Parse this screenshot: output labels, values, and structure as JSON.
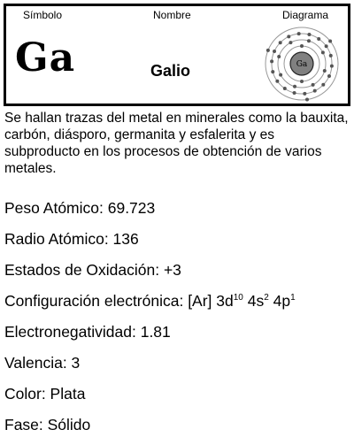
{
  "header": {
    "symbol_label": "Símbolo",
    "name_label": "Nombre",
    "diagram_label": "Diagrama"
  },
  "element": {
    "symbol": "Ga",
    "name": "Galio",
    "diagram_symbol": "Ga"
  },
  "description": "Se hallan trazas del metal en minerales como la bauxita, carbón, diásporo, germanita y esfalerita y es subproducto en los procesos de obtención de varios metales.",
  "properties": {
    "atomic_weight": "Peso Atómico: 69.723",
    "atomic_radius": "Radio Atómico: 136",
    "oxidation_states": "Estados de Oxidación: +3",
    "config_prefix": "Configuración electrónica: [Ar] 3d",
    "config_3d_exp": "10",
    "config_4s": " 4s",
    "config_4s_exp": "2",
    "config_4p": " 4p",
    "config_4p_exp": "1",
    "electronegativity": "Electronegatividad: 1.81",
    "valence": "Valencia: 3",
    "color": "Color: Plata",
    "phase": "Fase: Sólido"
  },
  "colors": {
    "nucleus": "#808080",
    "electron": "#555555"
  }
}
